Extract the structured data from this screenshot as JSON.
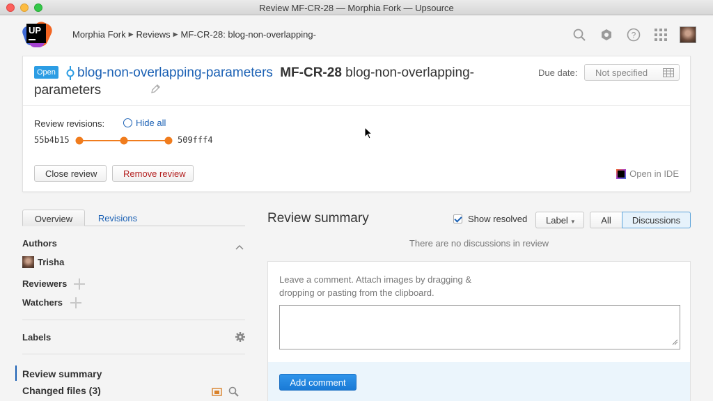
{
  "window": {
    "title": "Review MF-CR-28 — Morphia Fork — Upsource"
  },
  "header": {
    "logo_text": "UP",
    "breadcrumb": [
      "Morphia Fork",
      "Reviews",
      "MF-CR-28: blog-non-overlapping-"
    ],
    "icons": [
      "search-icon",
      "hexagon-icon",
      "help-icon",
      "apps-grid-icon",
      "user-avatar"
    ]
  },
  "review": {
    "status": "Open",
    "branch": "blog-non-overlapping-parameters",
    "code": "MF-CR-28",
    "title": "blog-non-overlapping-parameters",
    "due_label": "Due date:",
    "due_value": "Not specified",
    "revisions_label": "Review revisions:",
    "hide_all": "Hide all",
    "rev_start": "55b4b15",
    "rev_end": "509fff4",
    "revision_count": 3,
    "close_button": "Close review",
    "remove_button": "Remove review",
    "open_ide": "Open in IDE",
    "accent_color": "#f07c1d"
  },
  "sidebar": {
    "tabs": [
      "Overview",
      "Revisions"
    ],
    "authors_label": "Authors",
    "author_name": "Trisha",
    "reviewers_label": "Reviewers",
    "watchers_label": "Watchers",
    "labels_label": "Labels",
    "nav": [
      "Review summary",
      "Changed files (3)"
    ]
  },
  "main": {
    "summary_title": "Review summary",
    "show_resolved": "Show resolved",
    "show_resolved_checked": true,
    "label_button": "Label",
    "filter_all": "All",
    "filter_discussions": "Discussions",
    "no_discussions": "There are no discussions in review",
    "comment_hint": "Leave a comment. Attach images by dragging & dropping or pasting from the clipboard.",
    "add_comment": "Add comment"
  }
}
